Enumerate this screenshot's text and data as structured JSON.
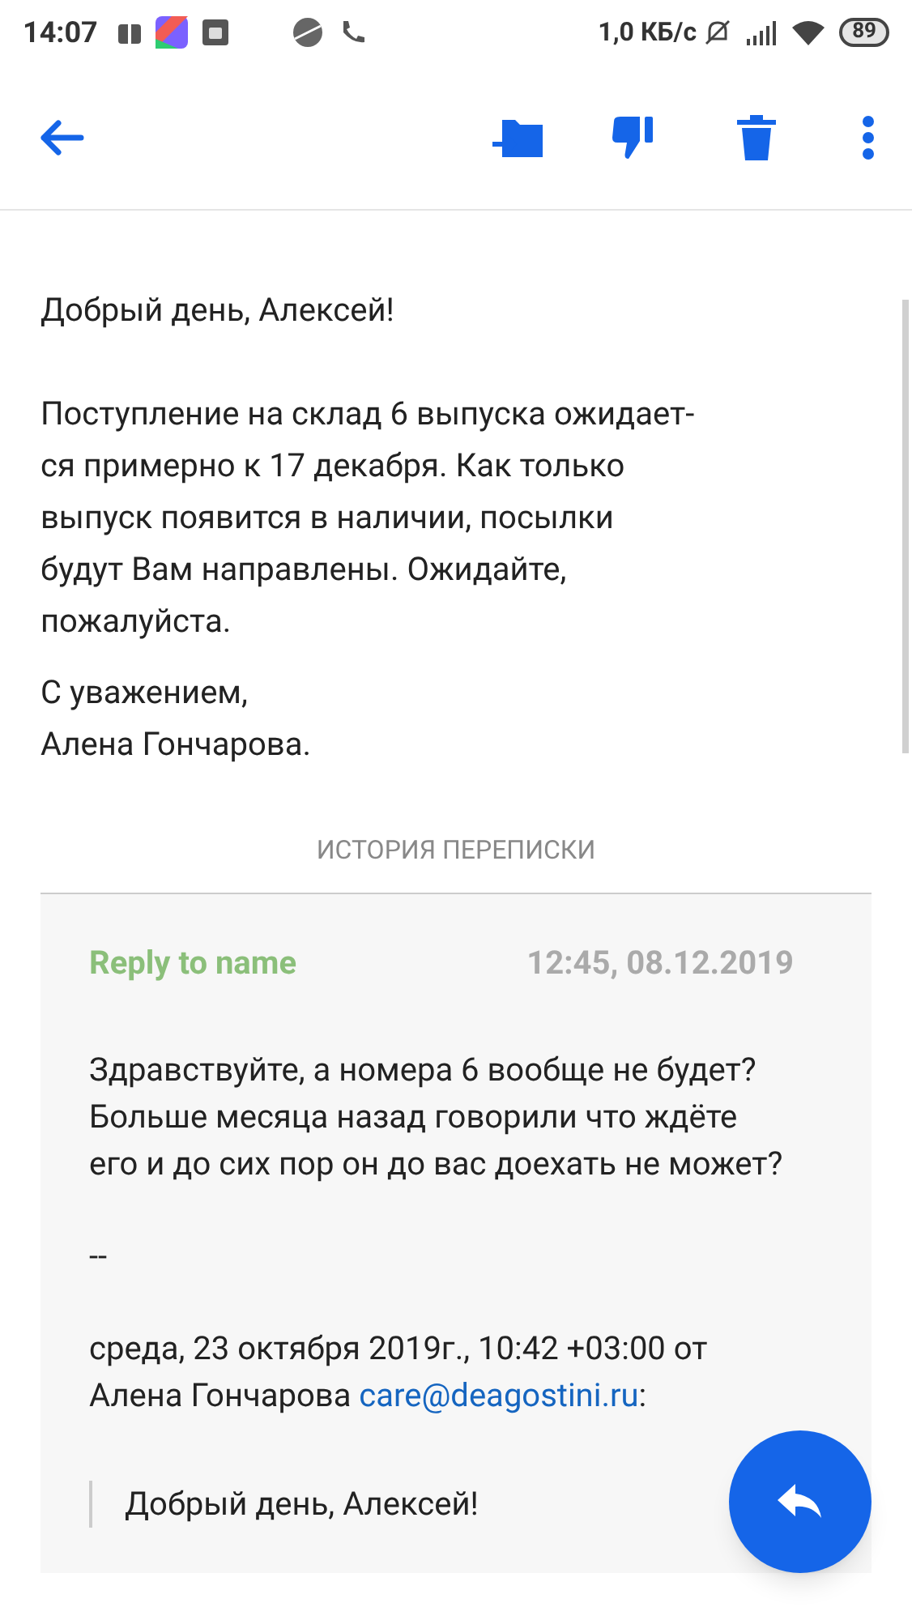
{
  "status_bar": {
    "time": "14:07",
    "speed": "1,0 КБ/с",
    "battery": "89"
  },
  "message": {
    "greeting": "Добрый день, Алексей!",
    "body_lines": [
      "Поступление на склад 6 выпуска ожидает-",
      "ся примерно к 17 декабря. Как только",
      "выпуск появится в наличии, посылки",
      "будут Вам направлены. Ожидайте,",
      "пожалуйста."
    ],
    "signature_lines": [
      "С уважением,",
      "Алена Гончарова."
    ]
  },
  "history": {
    "label": "ИСТОРИЯ ПЕРЕПИСКИ",
    "sender": "Reply to name",
    "date": "12:45, 08.12.2019",
    "text": "Здравствуйте, а номера 6 вообще не будет? Больше месяца назад говорили что ждёте его и до сих пор он до вас доехать не может?",
    "separator": "--",
    "quote_header": "среда, 23 октября 2019г., 10:42 +03:00 от Алена Гончарова",
    "quote_email": "care@deagostini.ru",
    "quote_suffix": ":",
    "quote_text": "Добрый день, Алексей!"
  }
}
